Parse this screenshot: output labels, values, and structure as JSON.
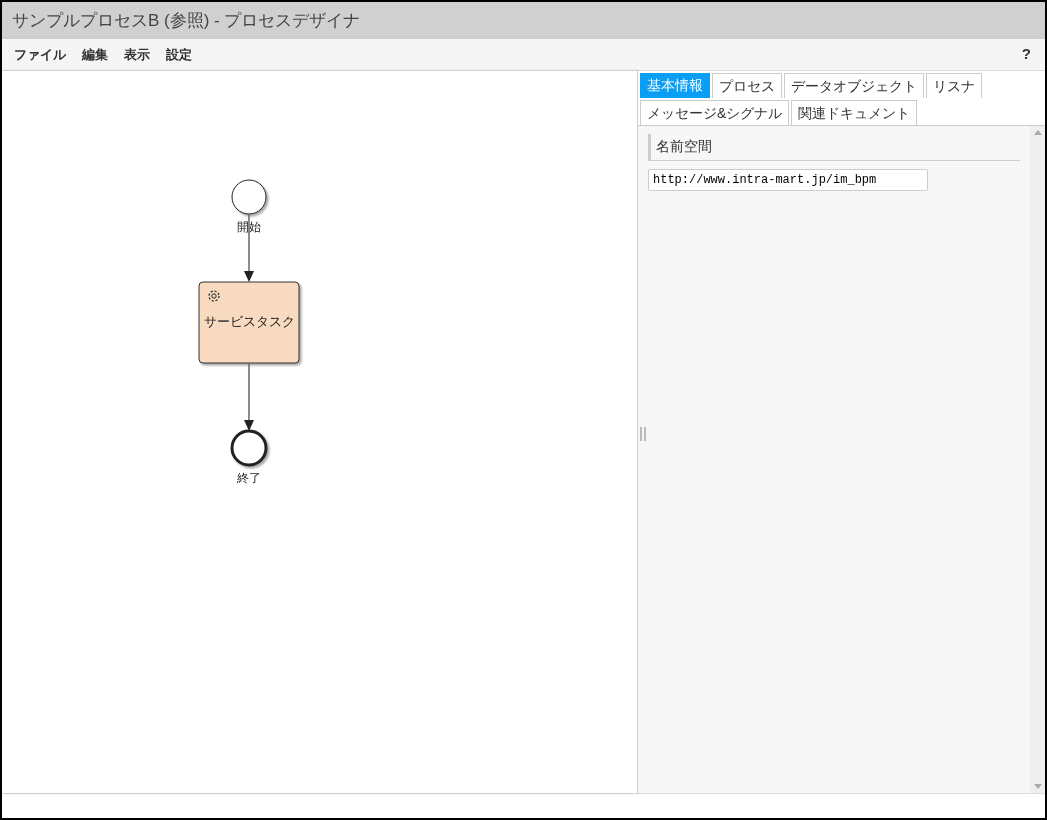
{
  "window": {
    "title": "サンプルプロセスB (参照) - プロセスデザイナ"
  },
  "menu": [
    "ファイル",
    "編集",
    "表示",
    "設定"
  ],
  "help": "?",
  "diagram": {
    "nodes": [
      {
        "kind": "start",
        "label": "開始"
      },
      {
        "kind": "service_task",
        "label": "サービスタスク"
      },
      {
        "kind": "end",
        "label": "終了"
      }
    ]
  },
  "tabs": [
    [
      {
        "label": "基本情報",
        "selected": true
      },
      {
        "label": "プロセス",
        "selected": false
      },
      {
        "label": "データオブジェクト",
        "selected": false
      },
      {
        "label": "リスナ",
        "selected": false
      }
    ],
    [
      {
        "label": "メッセージ&シグナル",
        "selected": false
      },
      {
        "label": "関連ドキュメント",
        "selected": false
      }
    ]
  ],
  "section": {
    "title": "名前空間",
    "field_value": "http://www.intra-mart.jp/im_bpm"
  }
}
